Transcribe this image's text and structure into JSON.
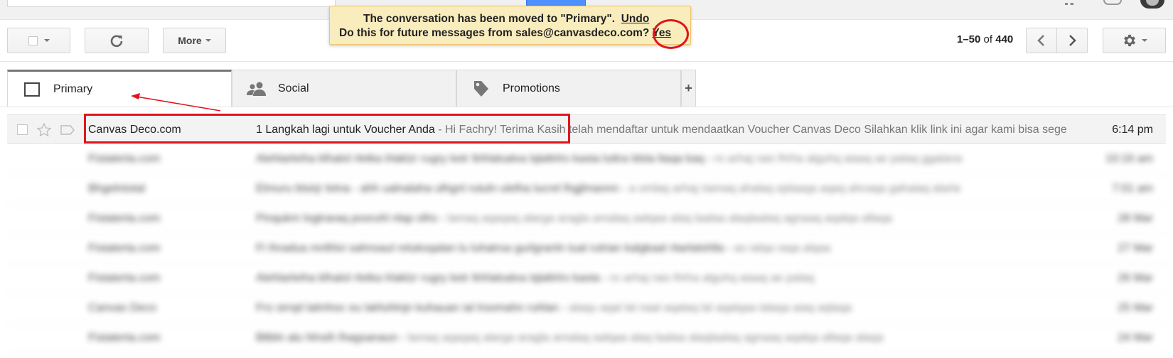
{
  "notice": {
    "line1": "The conversation has been moved to \"Primary\".",
    "undo": "Undo",
    "line2": "Do this for future messages from sales@canvasdeco.com?",
    "yes": "Yes"
  },
  "toolbar": {
    "more_label": "More"
  },
  "pager": {
    "range": "1–50",
    "of": "of",
    "total": "440"
  },
  "tabs": [
    {
      "label": "Primary",
      "icon": "inbox-icon"
    },
    {
      "label": "Social",
      "icon": "people-icon"
    },
    {
      "label": "Promotions",
      "icon": "tag-icon"
    },
    {
      "label": "+",
      "icon": "add-tab"
    }
  ],
  "mail": {
    "first": {
      "sender": "Canvas Deco.com",
      "subject": "1 Langkah lagi untuk Voucher Anda",
      "snippet": " - Hi Fachry! Terima Kasih telah mendaftar untuk mendaatkan Voucher Canvas Deco Silahkan klik link ini agar kami bisa sege",
      "time": "6:14 pm"
    },
    "blurred": [
      {
        "sender": "Fistaterta.com",
        "subject": "Alehlarleiha klhalol rletka lrlaklzr rugry ketr ltrlrlaloalva lqlaltrlro kasta luttra ldsla ltaqa kaq -",
        "snippet": "ro arhaj raio lhrha alguhq aiaaq ae palaq ggalana",
        "time": "10:16 am"
      },
      {
        "sender": "Bhgelntotal",
        "subject": "Elmuru blsirjr letna - ahh ualnalaha ulhgnl rutuln ulelha lucrel lhgjlmannn -",
        "snippet": "a omlaq arhaj riamaq ahalaq eplaaqa aqaq ahcaqa gahalaq alarla",
        "time": "7:01 am"
      },
      {
        "sender": "Fistaterta.com",
        "subject": "Pinqukm logtraraq posruhl nlap olhs -",
        "snippet": "lamaq aqaqaq alarga aragla amalaq aalqaa alaq laalaa alaqlaalaq agnaaq aqalqa allaqa",
        "time": "28 Mar"
      },
      {
        "sender": "Fistaterta.com",
        "subject": "Fi Ihradua mnlhlvi sahnsaul reluksqalan lu luhatrsa gurlgranln tual rulrian kalgkaal ritarlalshlla -",
        "snippet": "ao ialqa raqa alqaa",
        "time": "27 Mar"
      },
      {
        "sender": "Fistaterta.com",
        "subject": "Alehlarleiha klhalol rletka lrlaklzr rugry ketr ltrlrlaloalva lqlaltrlro kasta -",
        "snippet": "ro arhaj raio lhrha alguhq aiaaq ae palaq",
        "time": "26 Mar"
      },
      {
        "sender": "Canvas Deco",
        "subject": "Fro sirnpl lalmhoc eu lalrluhlnjn kuhauan ial lrsomahn ruhlan -",
        "snippet": "alaqu aqal lal naal aqalaq lal aqalqaa lalaqa aiaq aqlaqa",
        "time": "25 Mar"
      },
      {
        "sender": "Fistaterta.com",
        "subject": "Bltbln alu hlnsih lhagsanaun -",
        "snippet": "lamaq aqaqaq alarga aragla amalaq aalqaa alaq laalaa alaqlaalaq agnaaq aqalqa allaqa alaqa",
        "time": "24 Mar"
      }
    ]
  },
  "colors": {
    "annotation": "#e2141c",
    "notice_bg": "#f9edbe",
    "tab_active_border": "#777777"
  }
}
